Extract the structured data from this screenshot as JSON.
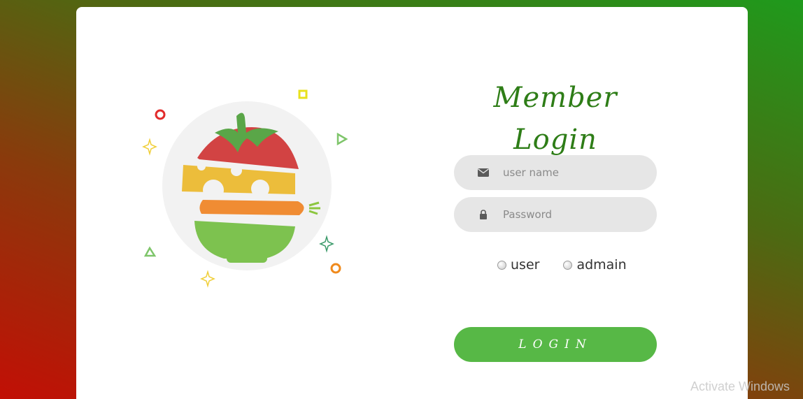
{
  "login": {
    "title": "Member Login",
    "username_placeholder": "user name",
    "password_placeholder": "Password",
    "roles": [
      "user",
      "admain"
    ],
    "button_label": "LOGIN"
  },
  "icons": {
    "username": "envelope-icon",
    "password": "lock-icon"
  },
  "colors": {
    "accent": "#57b846",
    "title": "#2e7d17",
    "field_bg": "#e6e6e6"
  },
  "watermark": "Activate Windows"
}
